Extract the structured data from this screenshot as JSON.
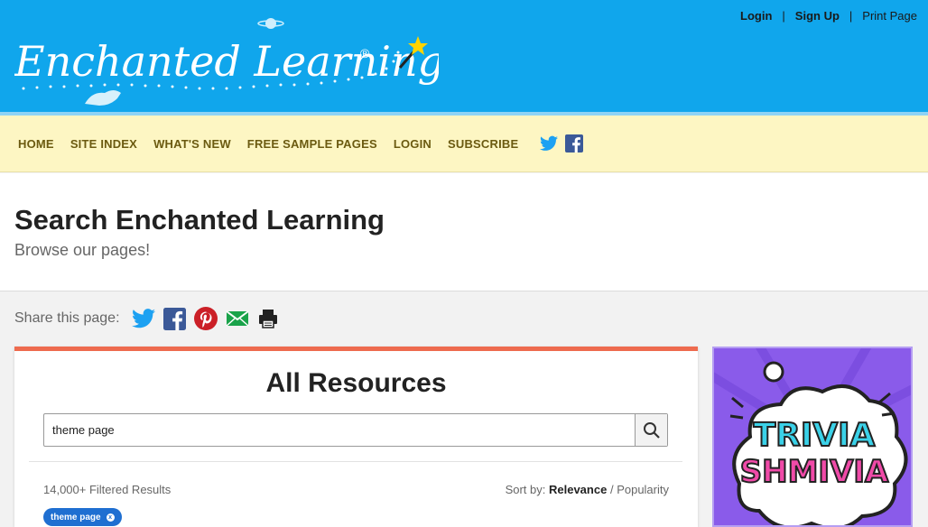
{
  "logo": {
    "text": "Enchanted Learning",
    "reg": "®"
  },
  "account": {
    "login": "Login",
    "signup": "Sign Up",
    "print": "Print Page",
    "sep": "|"
  },
  "nav": {
    "items": [
      "HOME",
      "SITE INDEX",
      "WHAT'S NEW",
      "FREE SAMPLE PAGES",
      "LOGIN",
      "SUBSCRIBE"
    ],
    "social": [
      "twitter-icon",
      "facebook-icon"
    ]
  },
  "header": {
    "title": "Search Enchanted Learning",
    "subtitle": "Browse our pages!"
  },
  "share": {
    "label": "Share this page:",
    "icons": [
      "twitter-icon",
      "facebook-icon",
      "pinterest-icon",
      "email-icon",
      "print-icon"
    ]
  },
  "panel": {
    "title": "All Resources",
    "search_value": "theme page",
    "results_text": "14,000+ Filtered Results",
    "sort_label": "Sort by:",
    "sort_active": "Relevance",
    "sort_sep": "/",
    "sort_other": "Popularity",
    "chip_label": "theme page",
    "chip_close": "x"
  },
  "ad": {
    "line1": "TRIVIA",
    "line2": "SHMIVIA"
  },
  "colors": {
    "topbar": "#10a6ec",
    "nav_bg": "#fdf6c3",
    "accent": "#ee6b4f",
    "chip": "#1f6fd1",
    "ad_bg": "#8a5bea"
  }
}
